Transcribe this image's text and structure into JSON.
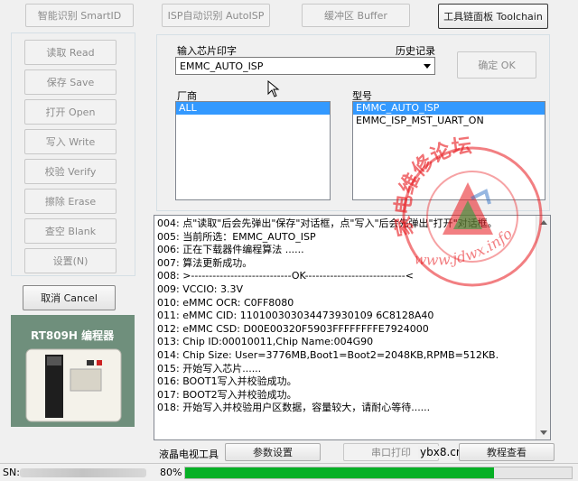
{
  "top_tabs": [
    {
      "label": "智能识别 SmartID",
      "state": "disabled"
    },
    {
      "label": "ISP自动识别 AutoISP",
      "state": "disabled"
    },
    {
      "label": "缓冲区 Buffer",
      "state": "disabled"
    },
    {
      "label": "工具链面板 Toolchain",
      "state": "active"
    }
  ],
  "side_buttons": [
    {
      "label": "读取 Read"
    },
    {
      "label": "保存 Save"
    },
    {
      "label": "打开 Open"
    },
    {
      "label": "写入 Write"
    },
    {
      "label": "校验 Verify"
    },
    {
      "label": "擦除 Erase"
    },
    {
      "label": "查空 Blank"
    },
    {
      "label": "设置(N)"
    }
  ],
  "cancel_label": "取消 Cancel",
  "product": {
    "title": "RT809H 编程器"
  },
  "chip_input": {
    "label": "输入芯片印字",
    "history_label": "历史记录",
    "value": "EMMC_AUTO_ISP"
  },
  "ok_label": "确定 OK",
  "vendor": {
    "label": "厂商",
    "items": [
      "ALL"
    ],
    "selected": 0
  },
  "model": {
    "label": "型号",
    "items": [
      "EMMC_AUTO_ISP",
      "EMMC_ISP_MST_UART_ON"
    ],
    "selected": 0
  },
  "log": [
    "004: 点\"读取\"后会先弹出\"保存\"对话框，点\"写入\"后会先弹出\"打开\"对话框。",
    "005: 当前所选：EMMC_AUTO_ISP",
    "006: 正在下载器件编程算法 ......",
    "007: 算法更新成功。",
    "008: >----------------------------OK----------------------------<",
    "009: VCCIO: 3.3V",
    "010: eMMC OCR: C0FF8080",
    "011: eMMC CID:  110100303034473930109 6C8128A40",
    "012: eMMC CSD: D00E00320F5903FFFFFFFFE7924000",
    "013: Chip ID:00010011,Chip Name:004G90",
    "014: Chip Size: User=3776MB,Boot1=Boot2=2048KB,RPMB=512KB.",
    "015: 开始写入芯片......",
    "016: BOOT1写入并校验成功。",
    "017: BOOT2写入并校验成功。",
    "018: 开始写入并校验用户区数据，容量较大，请耐心等待......"
  ],
  "bottom": {
    "tool_label": "液晶电视工具",
    "params_label": "参数设置",
    "serial_label": "串口打印",
    "tutorial_label": "教程查看",
    "site_text": "ybx8.cn"
  },
  "status": {
    "sn_label": "SN:",
    "progress_text": "80%",
    "progress": 0.8
  },
  "watermark": {
    "ring_text": "家电维修论坛",
    "url": "www.jdwx.info"
  },
  "colors": {
    "progress": "#06b025",
    "selection": "#3399ff",
    "watermark": "#e8161b"
  }
}
